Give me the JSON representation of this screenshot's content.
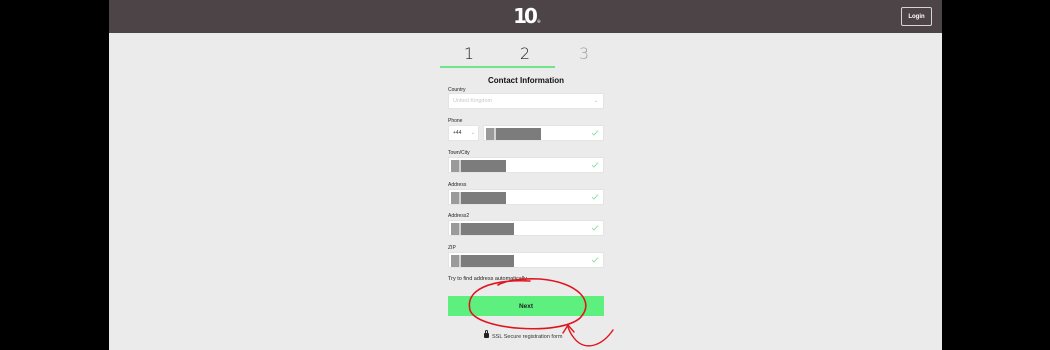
{
  "header": {
    "logo_text": "10",
    "logo_mark": "®",
    "login_label": "Login"
  },
  "steps": [
    {
      "number": "1",
      "state": "done"
    },
    {
      "number": "2",
      "state": "active"
    },
    {
      "number": "3",
      "state": "upcoming"
    }
  ],
  "form": {
    "title": "Contact Information",
    "country": {
      "label": "Country",
      "value": "United Kingdom"
    },
    "phone": {
      "label": "Phone",
      "code": "+44",
      "value": ""
    },
    "town": {
      "label": "Town/City",
      "value": ""
    },
    "address": {
      "label": "Address",
      "value": ""
    },
    "address2": {
      "label": "Address2",
      "value": ""
    },
    "zip": {
      "label": "ZIP",
      "value": ""
    },
    "find_address_link": "Try to find address automatically",
    "next_label": "Next",
    "ssl_note": "SSL Secure registration form"
  },
  "colors": {
    "header_bg": "#4c4446",
    "accent_green": "#5ef07f",
    "annotation_red": "#e0141e",
    "page_bg": "#ebebeb"
  }
}
